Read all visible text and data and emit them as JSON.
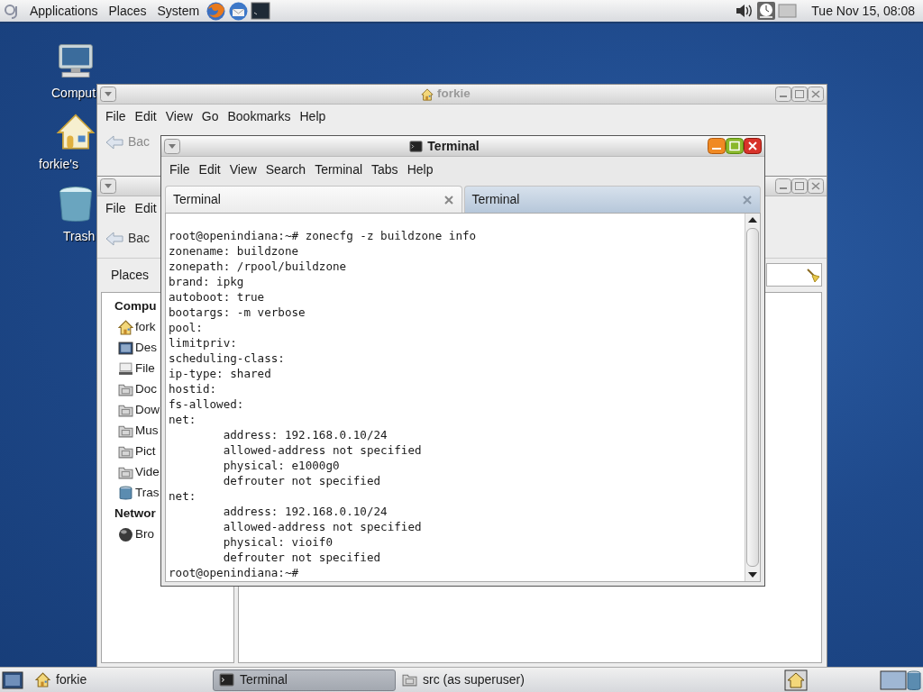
{
  "top_panel": {
    "menus": [
      "Applications",
      "Places",
      "System"
    ],
    "clock": "Tue Nov 15, 08:08"
  },
  "desktop_icons": [
    {
      "label": "Comput",
      "kind": "computer"
    },
    {
      "label": "forkie's",
      "kind": "home"
    },
    {
      "label": "Trash",
      "kind": "trash"
    }
  ],
  "file_manager_back": {
    "title": "forkie",
    "menus": [
      "File",
      "Edit",
      "View",
      "Go",
      "Bookmarks",
      "Help"
    ],
    "back_button": "Bac"
  },
  "file_manager_front": {
    "menus": [
      "File",
      "Edit"
    ],
    "back_button": "Bac",
    "sidebar_selector": "Places",
    "sidebar": [
      {
        "heading": "Compu",
        "items": [
          {
            "label": "fork",
            "kind": "home"
          },
          {
            "label": "Des",
            "kind": "desktop"
          },
          {
            "label": "File",
            "kind": "drive"
          },
          {
            "label": "Doc",
            "kind": "folder"
          },
          {
            "label": "Dow",
            "kind": "folder"
          },
          {
            "label": "Mus",
            "kind": "folder"
          },
          {
            "label": "Pict",
            "kind": "folder"
          },
          {
            "label": "Vide",
            "kind": "folder"
          },
          {
            "label": "Tras",
            "kind": "trash"
          }
        ]
      },
      {
        "heading": "Networ",
        "items": [
          {
            "label": "Bro",
            "kind": "network"
          }
        ]
      }
    ]
  },
  "terminal": {
    "title": "Terminal",
    "menus": [
      "File",
      "Edit",
      "View",
      "Search",
      "Terminal",
      "Tabs",
      "Help"
    ],
    "tabs": [
      {
        "label": "Terminal",
        "selected": true
      },
      {
        "label": "Terminal",
        "selected": false
      }
    ],
    "lines": [
      "root@openindiana:~# zonecfg -z buildzone info",
      "zonename: buildzone",
      "zonepath: /rpool/buildzone",
      "brand: ipkg",
      "autoboot: true",
      "bootargs: -m verbose",
      "pool:",
      "limitpriv:",
      "scheduling-class:",
      "ip-type: shared",
      "hostid:",
      "fs-allowed:",
      "net:",
      "\taddress: 192.168.0.10/24",
      "\tallowed-address not specified",
      "\tphysical: e1000g0",
      "\tdefrouter not specified",
      "net:",
      "\taddress: 192.168.0.10/24",
      "\tallowed-address not specified",
      "\tphysical: vioif0",
      "\tdefrouter not specified",
      "root@openindiana:~#"
    ]
  },
  "taskbar": {
    "tasks": [
      {
        "label": "forkie",
        "kind": "home",
        "selected": false
      },
      {
        "label": "Terminal",
        "kind": "terminal",
        "selected": true
      },
      {
        "label": "src (as superuser)",
        "kind": "folder",
        "selected": false
      }
    ]
  }
}
